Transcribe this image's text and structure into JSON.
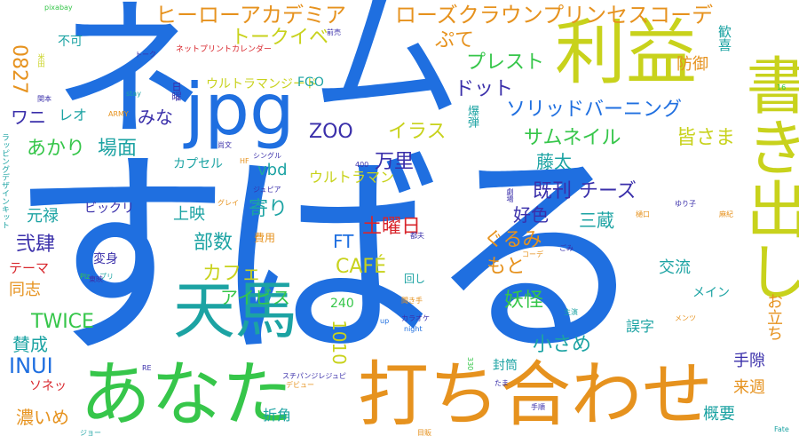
{
  "colors": {
    "blue": "#1f6fe0",
    "yellow": "#c8d21c",
    "orange": "#e6921e",
    "green": "#36c64a",
    "red": "#d8262c",
    "teal": "#1ca3a3",
    "purple": "#3a2faa",
    "light": "#79d36a"
  },
  "words": [
    "すばる",
    "ネ",
    "ム",
    "jpg",
    "利益",
    "書き出し",
    "天馬",
    "あなた",
    "打ち合わせ",
    "ヒーローアカデミア",
    "ローズクラウンプリンセスコーデ",
    "トークイベ",
    "ぷて",
    "プレスト",
    "ドット",
    "ソリッドバーニング",
    "サムネイル",
    "皆さま",
    "ZOO",
    "イラス",
    "防御",
    "歓喜",
    "チーズ",
    "既刊",
    "万里",
    "藤太",
    "土曜日",
    "好色",
    "三蔵",
    "ぐるみ",
    "寄り",
    "上映",
    "ビックリ",
    "元禄",
    "弐肆",
    "テーマ",
    "同志",
    "部数",
    "カフェ",
    "CAFÉ",
    "FT",
    "もと",
    "交流",
    "アイビス",
    "変身",
    "妖怪",
    "小さめ",
    "TWICE",
    "賛成",
    "INUI",
    "ワニ",
    "レオ",
    "みな",
    "あかり",
    "場面",
    "カプセル",
    "vbd",
    "ウルトラマン",
    "ウルトラマンジード",
    "FGO",
    "不可",
    "0827",
    "1010",
    "240",
    "濃いめ",
    "ソネッ",
    "折角",
    "手隙",
    "来週",
    "概要",
    "お立ち",
    "誤字",
    "メイン",
    "封筒",
    "爆弾",
    "ネットプリントカレンダー",
    "pixabay",
    "前売",
    "トーク",
    "日曜",
    "米田",
    "関本",
    "stay",
    "ARMY",
    "尚文",
    "シングル",
    "HF",
    "400",
    "ジュピア",
    "グレイ",
    "費用",
    "回し",
    "聞き手",
    "ゆり子",
    "劇場",
    "樋口",
    "都夫",
    "麻紀",
    "ごみ",
    "コーデ",
    "カラオケ",
    "night",
    "up",
    "主演",
    "メンツ",
    "RE",
    "330",
    "スチパンジレジュピ",
    "デビュー",
    "たま",
    "手順",
    "Fate",
    "ジョー",
    "目販",
    "16",
    "東映",
    "Plz",
    "プリ",
    "ラッピングデザインキット"
  ]
}
